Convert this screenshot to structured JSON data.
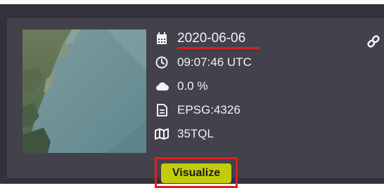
{
  "scene": {
    "date": "2020-06-06",
    "time": "09:07:46 UTC",
    "cloud_cover": "0.0 %",
    "crs": "EPSG:4326",
    "tile": "35TQL",
    "visualize_label": "Visualize"
  },
  "icons": {
    "date": "calendar-icon",
    "time": "clock-icon",
    "cloud": "cloud-icon",
    "crs": "file-icon",
    "tile": "map-icon",
    "link": "link-icon"
  },
  "colors": {
    "panel_bg": "#33323b",
    "card_bg": "#42414c",
    "text": "#f2f2f2",
    "accent_button": "#c3cc0a",
    "highlight": "#e01e1e"
  }
}
